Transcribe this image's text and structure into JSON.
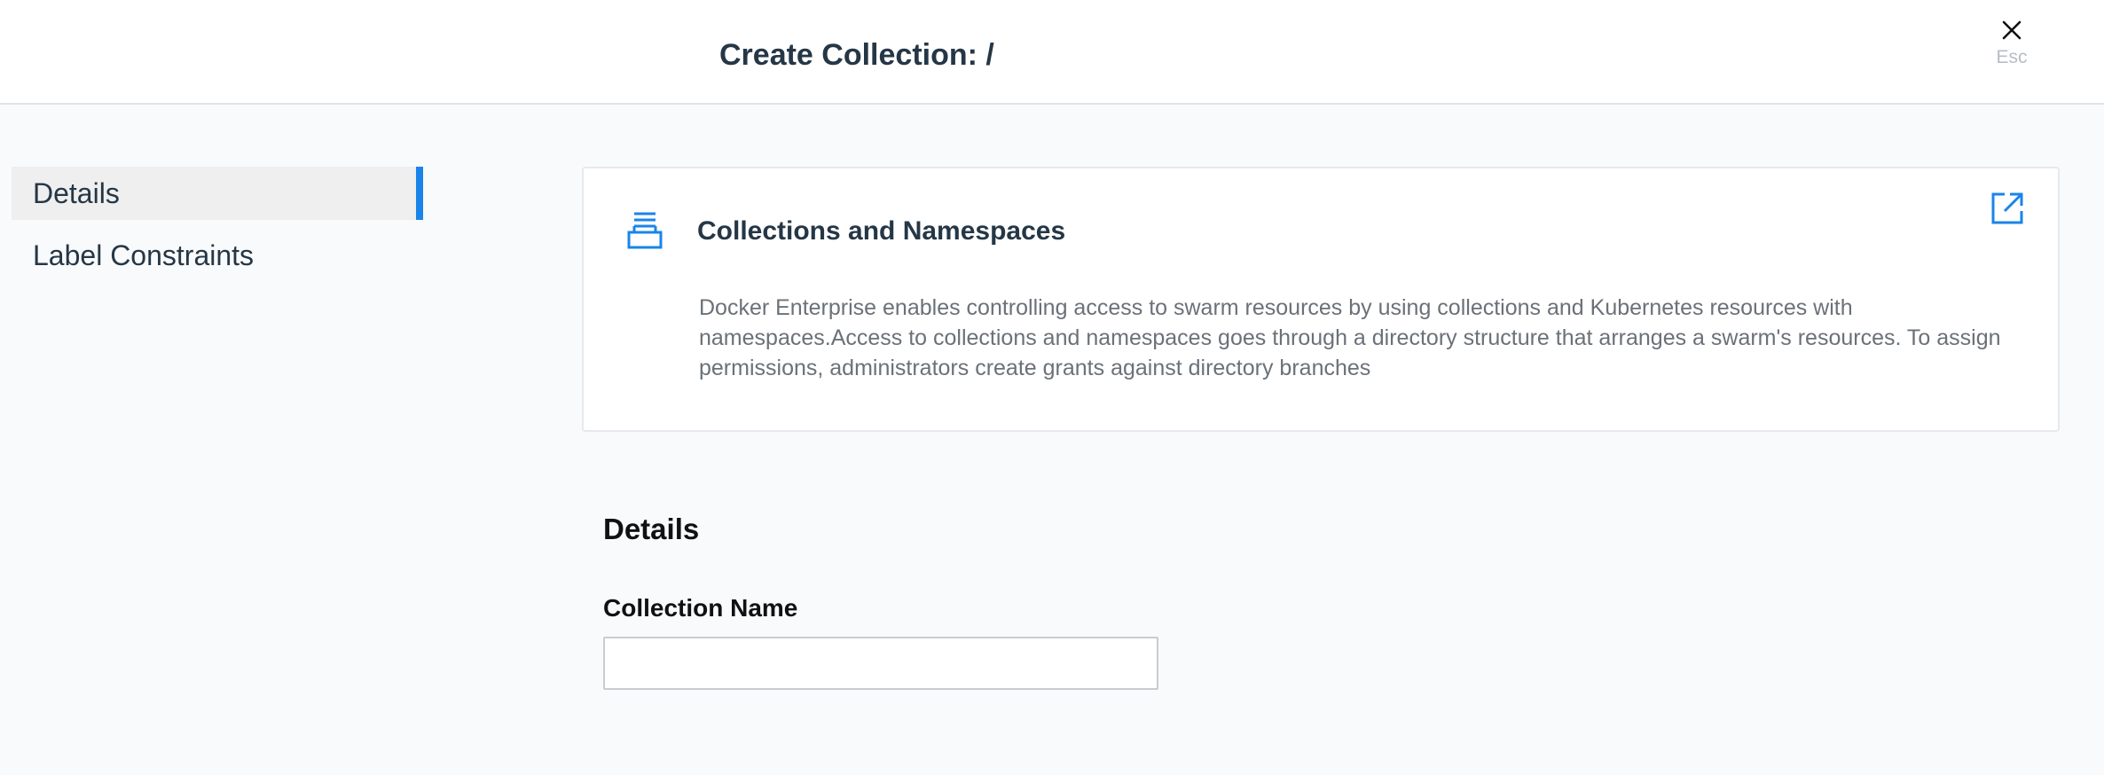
{
  "header": {
    "title": "Create Collection: /",
    "close_icon": "close-icon",
    "esc_label": "Esc"
  },
  "sidebar": {
    "items": [
      {
        "label": "Details",
        "active": true
      },
      {
        "label": "Label Constraints",
        "active": false
      }
    ]
  },
  "info_card": {
    "icon": "stacked-layers-icon",
    "title": "Collections and Namespaces",
    "body": "Docker Enterprise enables controlling access to swarm resources by using collections and Kubernetes resources with namespaces.Access to collections and namespaces goes through a directory structure that arranges a swarm's resources. To assign permissions, administrators create grants against directory branches",
    "link_icon": "external-link-icon"
  },
  "form": {
    "section_heading": "Details",
    "collection_name_label": "Collection Name",
    "collection_name_value": "",
    "collection_name_placeholder": ""
  },
  "colors": {
    "accent": "#1a84ea",
    "title_text": "#253746",
    "body_text": "#6b7178",
    "page_background": "#f9fafb"
  }
}
